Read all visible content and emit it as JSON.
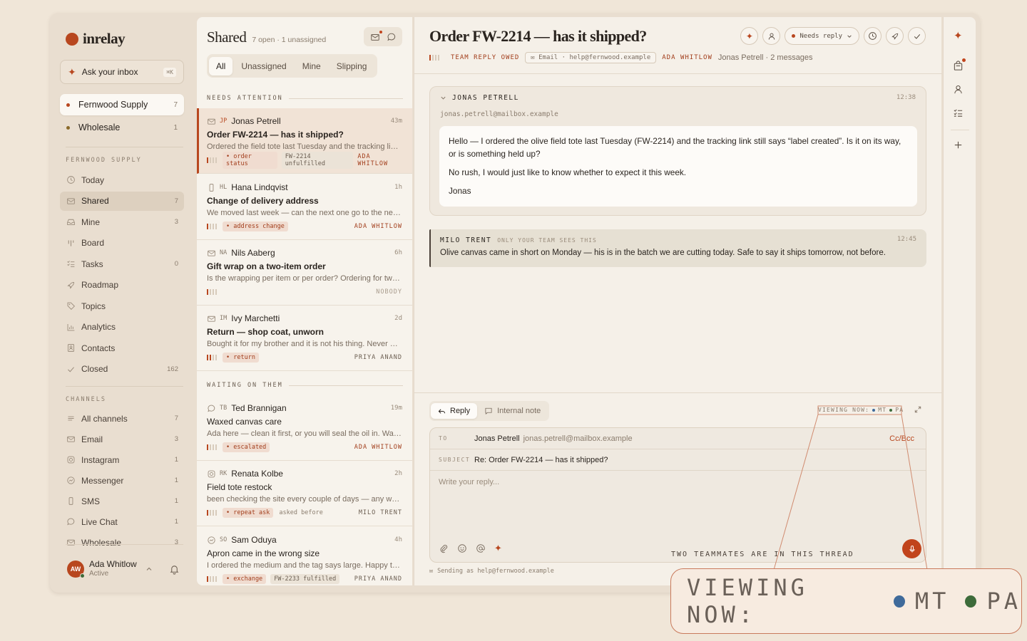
{
  "app": {
    "name": "inrelay"
  },
  "sidebar": {
    "ask": {
      "label": "Ask your inbox",
      "shortcut": "⌘K"
    },
    "workspaces": [
      {
        "name": "Fernwood Supply",
        "count": "7",
        "color": "#b8471f",
        "active": true
      },
      {
        "name": "Wholesale",
        "count": "1",
        "color": "#8a6a2a",
        "active": false
      }
    ],
    "section_label": "FERNWOOD SUPPLY",
    "nav": [
      {
        "label": "Today",
        "count": "",
        "icon": "clock-icon"
      },
      {
        "label": "Shared",
        "count": "7",
        "icon": "inbox-icon"
      },
      {
        "label": "Mine",
        "count": "3",
        "icon": "tray-icon"
      },
      {
        "label": "Board",
        "count": "",
        "icon": "board-icon"
      },
      {
        "label": "Tasks",
        "count": "0",
        "icon": "checklist-icon"
      },
      {
        "label": "Roadmap",
        "count": "",
        "icon": "rocket-icon"
      },
      {
        "label": "Topics",
        "count": "",
        "icon": "tag-icon"
      },
      {
        "label": "Analytics",
        "count": "",
        "icon": "chart-icon"
      },
      {
        "label": "Contacts",
        "count": "",
        "icon": "contact-icon"
      },
      {
        "label": "Closed",
        "count": "162",
        "icon": "check-icon"
      }
    ],
    "channels_label": "CHANNELS",
    "channels": [
      {
        "label": "All channels",
        "count": "7",
        "icon": "lines-icon"
      },
      {
        "label": "Email",
        "count": "3",
        "icon": "mail-icon"
      },
      {
        "label": "Instagram",
        "count": "1",
        "icon": "instagram-icon"
      },
      {
        "label": "Messenger",
        "count": "1",
        "icon": "messenger-icon"
      },
      {
        "label": "SMS",
        "count": "1",
        "icon": "phone-icon"
      },
      {
        "label": "Live Chat",
        "count": "1",
        "icon": "chat-icon"
      },
      {
        "label": "Wholesale",
        "count": "3",
        "icon": "mail-icon"
      }
    ],
    "user": {
      "initials": "AW",
      "name": "Ada Whitlow",
      "status": "Active"
    }
  },
  "list": {
    "title": "Shared",
    "subtitle": "7 open · 1 unassigned",
    "tabs": [
      "All",
      "Unassigned",
      "Mine",
      "Slipping"
    ],
    "active_tab": "All",
    "group1": "NEEDS ATTENTION",
    "group2": "WAITING ON THEM",
    "items": [
      {
        "initials": "JP",
        "name": "Jonas Petrell",
        "time": "43m",
        "subject": "Order FW-2214 — has it shipped?",
        "preview": "Ordered the field tote last Tuesday and the tracking link still says \"label created\"",
        "pills": [
          {
            "text": "• order status",
            "kind": "acc"
          },
          {
            "text": "FW-2214 unfulfilled",
            "kind": "neu"
          }
        ],
        "assignee": "ADA WHITLOW",
        "bars": 1,
        "bold": true
      },
      {
        "initials": "HL",
        "name": "Hana Lindqvist",
        "time": "1h",
        "subject": "Change of delivery address",
        "preview": "We moved last week — can the next one go to the new place?",
        "pills": [
          {
            "text": "• address change",
            "kind": "acc"
          }
        ],
        "assignee": "ADA WHITLOW",
        "bars": 1,
        "bold": true
      },
      {
        "initials": "NA",
        "name": "Nils Aaberg",
        "time": "6h",
        "subject": "Gift wrap on a two-item order",
        "preview": "Is the wrapping per item or per order? Ordering for two people",
        "pills": [],
        "assignee": "NOBODY",
        "bars": 1,
        "bold": true
      },
      {
        "initials": "IM",
        "name": "Ivy Marchetti",
        "time": "2d",
        "subject": "Return — shop coat, unworn",
        "preview": "Bought it for my brother and it is not his thing. Never worn, tags on",
        "pills": [
          {
            "text": "• return",
            "kind": "acc"
          }
        ],
        "assignee": "PRIYA ANAND",
        "bars": 2,
        "bold": true
      },
      {
        "initials": "TB",
        "name": "Ted Brannigan",
        "time": "19m",
        "subject": "Waxed canvas care",
        "preview": "Ada here — clean it first, or you will seal the oil in. Warm water",
        "pills": [
          {
            "text": "• escalated",
            "kind": "acc"
          }
        ],
        "assignee": "ADA WHITLOW",
        "bars": 1,
        "bold": false
      },
      {
        "initials": "RK",
        "name": "Renata Kolbe",
        "time": "2h",
        "subject": "Field tote restock",
        "preview": "been checking the site every couple of days — any word on when",
        "pills": [
          {
            "text": "• repeat ask",
            "kind": "acc"
          },
          {
            "text": "asked before",
            "kind": "plain"
          }
        ],
        "assignee": "MILO TRENT",
        "bars": 1,
        "bold": false
      },
      {
        "initials": "SO",
        "name": "Sam Oduya",
        "time": "4h",
        "subject": "Apron came in the wrong size",
        "preview": "I ordered the medium and the tag says large. Happy to swap",
        "pills": [
          {
            "text": "• exchange",
            "kind": "acc"
          },
          {
            "text": "FW-2233 fulfilled",
            "kind": "neu"
          }
        ],
        "assignee": "PRIYA ANAND",
        "bars": 1,
        "bold": false
      }
    ]
  },
  "detail": {
    "title": "Order FW-2214 — has it shipped?",
    "meta": {
      "team": "TEAM REPLY OWED",
      "channel": "Email · help@fernwood.example",
      "assignee": "ADA WHITLOW",
      "summary": "Jonas Petrell · 2 messages"
    },
    "status": "Needs reply",
    "message": {
      "sender": "JONAS PETRELL",
      "time": "12:38",
      "email": "jonas.petrell@mailbox.example",
      "p1": "Hello — I ordered the olive field tote last Tuesday (FW-2214) and the tracking link still says “label created”. Is it on its way, or is something held up?",
      "p2": "No rush, I would just like to know whether to expect it this week.",
      "p3": "Jonas"
    },
    "note": {
      "sender": "MILO TRENT",
      "visibility": "ONLY YOUR TEAM SEES THIS",
      "time": "12:45",
      "text": "Olive canvas came in short on Monday — his is in the batch we are cutting today. Safe to say it ships tomorrow, not before."
    },
    "compose": {
      "reply_tab": "Reply",
      "note_tab": "Internal note",
      "viewing_label": "VIEWING NOW:",
      "viewers": [
        {
          "initials": "MT",
          "color": "#3f6a9a"
        },
        {
          "initials": "PA",
          "color": "#3d6b3a"
        }
      ],
      "to_label": "TO",
      "to_name": "Jonas Petrell",
      "to_email": "jonas.petrell@mailbox.example",
      "ccbcc": "Cc/Bcc",
      "subject_label": "SUBJECT",
      "subject": "Re: Order FW-2214 — has it shipped?",
      "placeholder": "Write your reply...",
      "presence": "TWO TEAMMATES ARE IN THIS THREAD",
      "sending": "Sending as help@fernwood.example"
    }
  },
  "zoom": {
    "label": "VIEWING NOW:",
    "v1": "MT",
    "v2": "PA"
  }
}
